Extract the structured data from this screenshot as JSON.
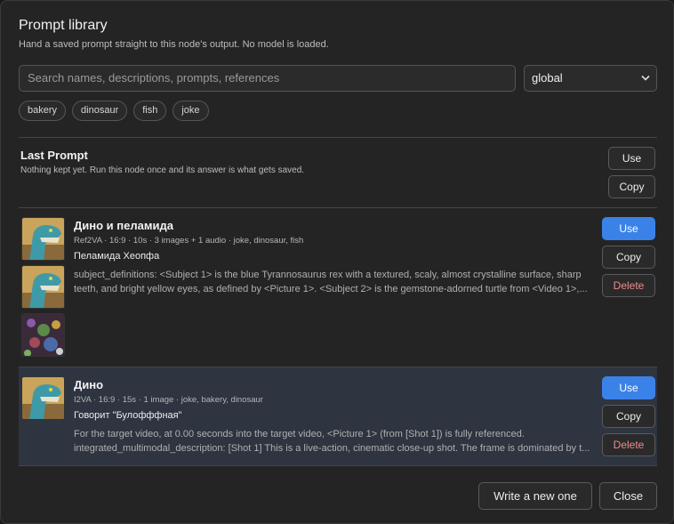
{
  "dialog": {
    "title": "Prompt library",
    "subtitle": "Hand a saved prompt straight to this node's output. No model is loaded."
  },
  "search": {
    "placeholder": "Search names, descriptions, prompts, references"
  },
  "scope": {
    "selected": "global"
  },
  "tags": [
    "bakery",
    "dinosaur",
    "fish",
    "joke"
  ],
  "last_prompt": {
    "title": "Last Prompt",
    "note": "Nothing kept yet. Run this node once and its answer is what gets saved.",
    "use_label": "Use",
    "copy_label": "Copy"
  },
  "entries": [
    {
      "title": "Дино и пеламида",
      "meta": "Ref2VA · 16:9 · 10s · 3 images + 1 audio · joke, dinosaur, fish",
      "subtitle": "Пеламида Хеопфа",
      "body": [
        "subject_definitions: <Subject 1> is the blue Tyrannosaurus rex with a textured, scaly, almost crystalline surface, sharp",
        "teeth, and bright yellow eyes, as defined by <Picture 1>. <Subject 2> is the gemstone-adorned turtle from <Video 1>,..."
      ],
      "use_label": "Use",
      "copy_label": "Copy",
      "delete_label": "Delete"
    },
    {
      "title": "Дино",
      "meta": "I2VA · 16:9 · 15s · 1 image · joke, bakery, dinosaur",
      "subtitle": "Говорит \"Булофффная\"",
      "body": [
        "For the target video, at 0.00 seconds into the target video, <Picture 1> (from [Shot 1]) is fully referenced.",
        "integrated_multimodal_description: [Shot 1] This is a live-action, cinematic close-up shot. The frame is dominated by t..."
      ],
      "use_label": "Use",
      "copy_label": "Copy",
      "delete_label": "Delete"
    }
  ],
  "footer": {
    "write_label": "Write a new one",
    "close_label": "Close"
  },
  "colors": {
    "accent": "#3b82e8",
    "danger": "#f08a8a",
    "selected_row": "#2e3440"
  }
}
